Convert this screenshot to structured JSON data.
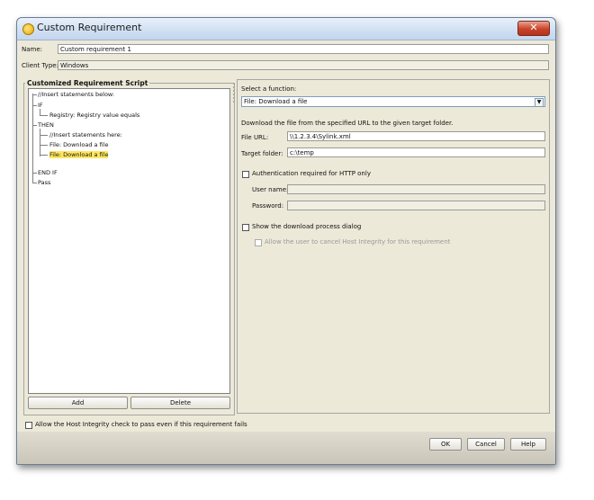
{
  "window": {
    "title": "Custom Requirement",
    "close_glyph": "✕"
  },
  "name": {
    "label": "Name:",
    "value": "Custom requirement 1"
  },
  "client_type": {
    "label": "Client Type:",
    "value": "Windows"
  },
  "script": {
    "group_title": "Customized Requirement Script",
    "tree": [
      "//Insert statements below:",
      "IF",
      "Registry: Registry value equals",
      "THEN",
      "//Insert statements here:",
      "File: Download a file",
      "File: Download a file",
      "END IF",
      "Pass"
    ],
    "add_label": "Add",
    "delete_label": "Delete"
  },
  "function": {
    "select_label": "Select a function:",
    "selected": "File: Download a file",
    "description": "Download the file from the specified URL to the given target folder.",
    "file_url_label": "File URL:",
    "file_url_value": "\\\\1.2.3.4\\Sylink.xml",
    "target_folder_label": "Target folder:",
    "target_folder_value": "c:\\temp",
    "auth_label": "Authentication required for HTTP only",
    "user_name_label": "User name:",
    "password_label": "Password:",
    "show_dialog_label": "Show the download process dialog",
    "allow_cancel_label": "Allow the user to cancel Host Integrity for this requirement"
  },
  "footer": {
    "allow_pass_label": "Allow the Host Integrity check to pass even if this requirement fails",
    "ok_label": "OK",
    "cancel_label": "Cancel",
    "help_label": "Help"
  }
}
